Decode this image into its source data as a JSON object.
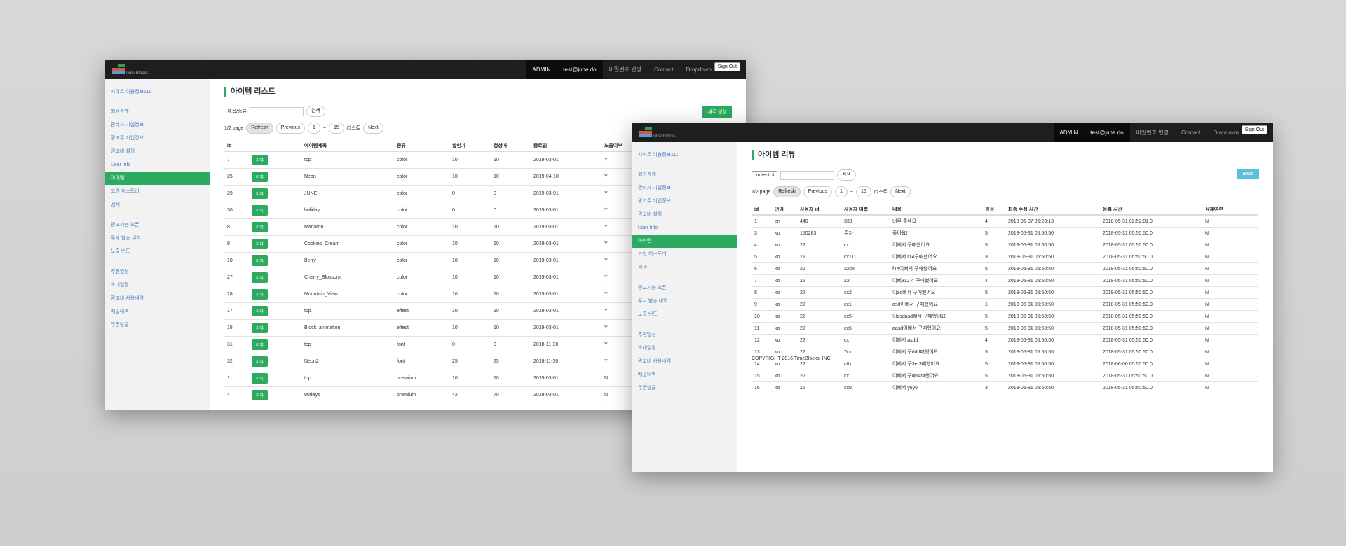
{
  "window1": {
    "nav": {
      "logo_text": "Time Blocks",
      "items": [
        "ADMIN",
        "test@june.do",
        "비밀번호 변경",
        "Contact",
        "Dropdown"
      ],
      "signout": "Sign Out"
    },
    "sidebar": {
      "items": [
        "사이트 이용정보111",
        "회원통계",
        "관리자 기업정보",
        "광고주 기업정보",
        "광고비 설정",
        "User Info",
        "아이템",
        "코인 히스토리",
        "검색",
        "광고기능 오픈",
        "푸시 발송 내역",
        "노출 빈도",
        "추천일정",
        "초대일정",
        "광고비 사용내역",
        "매출내역",
        "쿠폰발급"
      ],
      "active": "아이템"
    },
    "title": "아이템 리스트",
    "search_label": "- 제목/종류",
    "search_button": "검색",
    "new_button": "새로 생성",
    "pager": {
      "page": "1/2 page",
      "refresh": "Refresh",
      "previous": "Previous",
      "from": "1",
      "sep": "~",
      "to": "15",
      "unit": "리스트",
      "next": "Next"
    },
    "table": {
      "headers": [
        "id",
        "",
        "아이템제목",
        "종류",
        "할인가",
        "정상가",
        "종료일",
        "노출여부"
      ],
      "review_label": "리뷰",
      "rows": [
        [
          "7",
          "top",
          "color",
          "10",
          "10",
          "2019-03-01",
          "Y"
        ],
        [
          "25",
          "Neon",
          "color",
          "10",
          "10",
          "2019-04-10",
          "Y"
        ],
        [
          "29",
          "JUNE",
          "color",
          "0",
          "0",
          "2019-03-01",
          "Y"
        ],
        [
          "30",
          "holiday",
          "color",
          "0",
          "0",
          "2019-03-01",
          "Y"
        ],
        [
          "8",
          "Macaron",
          "color",
          "10",
          "10",
          "2019-03-01",
          "Y"
        ],
        [
          "9",
          "Cookies_Cream",
          "color",
          "10",
          "10",
          "2019-03-01",
          "Y"
        ],
        [
          "10",
          "Berry",
          "color",
          "10",
          "10",
          "2019-03-01",
          "Y"
        ],
        [
          "27",
          "Cherry_Blossom",
          "color",
          "10",
          "10",
          "2019-03-01",
          "Y"
        ],
        [
          "28",
          "Mountain_View",
          "color",
          "10",
          "10",
          "2019-03-01",
          "Y"
        ],
        [
          "17",
          "top",
          "effect",
          "10",
          "10",
          "2019-03-01",
          "Y"
        ],
        [
          "18",
          "Block_animation",
          "effect",
          "10",
          "10",
          "2019-03-01",
          "Y"
        ],
        [
          "31",
          "top",
          "font",
          "0",
          "0",
          "2018-11-30",
          "Y"
        ],
        [
          "32",
          "Neon2",
          "font",
          "25",
          "25",
          "2018-11-30",
          "Y"
        ],
        [
          "1",
          "top",
          "premium",
          "10",
          "10",
          "2019-03-01",
          "N"
        ],
        [
          "4",
          "90days",
          "premium",
          "42",
          "70",
          "2019-03-01",
          "N"
        ]
      ]
    }
  },
  "window2": {
    "nav": {
      "logo_text": "Time Blocks",
      "items": [
        "ADMIN",
        "test@june.do",
        "비밀번호 변경",
        "Contact",
        "Dropdown"
      ],
      "signout": "Sign Out"
    },
    "sidebar": {
      "items": [
        "사이트 이용정보111",
        "회원통계",
        "관리자 기업정보",
        "광고주 기업정보",
        "광고비 설정",
        "User Info",
        "아이템",
        "코인 히스토리",
        "검색",
        "광고기능 오픈",
        "푸시 발송 내역",
        "노출 빈도",
        "추천일정",
        "초대일정",
        "광고비 사용내역",
        "매출내역",
        "쿠폰발급"
      ],
      "active": "아이템"
    },
    "title": "아이템 리뷰",
    "filter_select": "content",
    "search_button": "검색",
    "back_button": "Back",
    "pager": {
      "page": "1/2 page",
      "refresh": "Refresh",
      "previous": "Previous",
      "from": "1",
      "sep": "~",
      "to": "15",
      "unit": "리스트",
      "next": "Next"
    },
    "table": {
      "headers": [
        "id",
        "언어",
        "사용자 id",
        "사용자 이름",
        "내용",
        "평점",
        "최종 수정 시간",
        "등록 시간",
        "삭제여부"
      ],
      "rows": [
        [
          "1",
          "en",
          "440",
          "333",
          "너무 좋네요~",
          "4",
          "2018-06-07 06:20:13",
          "2018-05-31 02:52:01.0",
          "N"
        ],
        [
          "3",
          "ko",
          "150283",
          "주차",
          "좋아요!",
          "5",
          "2018-05-31 05:50:50",
          "2018-05-31 05:50:50.0",
          "N"
        ],
        [
          "4",
          "ko",
          "22",
          "cx",
          "이뻐서 구매했어요",
          "5",
          "2018-05-31 05:50:50",
          "2018-05-31 05:50:50.0",
          "N"
        ],
        [
          "5",
          "ko",
          "22",
          "cx111",
          "이뻐서 r14구매했어요",
          "3",
          "2018-05-31 05:50:50",
          "2018-05-31 05:50:50.0",
          "N"
        ],
        [
          "6",
          "ko",
          "22",
          "22cx",
          "f44이뻐서 구매했어요",
          "5",
          "2018-05-31 05:50:50",
          "2018-05-31 05:50:50.0",
          "N"
        ],
        [
          "7",
          "ko",
          "22",
          "22",
          "이뻐312서 구매했어요",
          "4",
          "2018-05-31 05:50:50",
          "2018-05-31 05:50:50.0",
          "N"
        ],
        [
          "8",
          "ko",
          "22",
          "cx2",
          "이ad뻐서 구매했어요",
          "5",
          "2018-05-31 05:50:50",
          "2018-05-31 05:50:50.0",
          "N"
        ],
        [
          "9",
          "ko",
          "22",
          "cx1",
          "asd이뻐서 구매했어요",
          "1",
          "2018-05-31 05:50:50",
          "2018-05-31 05:50:50.0",
          "N"
        ],
        [
          "10",
          "ko",
          "22",
          "cx5",
          "이asdasd뻐서 구매했어요",
          "5",
          "2018-05-31 05:50:50",
          "2018-05-31 05:50:50.0",
          "N"
        ],
        [
          "11",
          "ko",
          "22",
          "cx6",
          "aasd이뻐서 구매했어요",
          "5",
          "2018-05-31 05:50:50",
          "2018-05-31 05:50:50.0",
          "N"
        ],
        [
          "12",
          "ko",
          "22",
          "cx",
          "이뻐서 asdd",
          "4",
          "2018-05-31 05:50:50",
          "2018-05-31 05:50:50.0",
          "N"
        ],
        [
          "13",
          "ko",
          "22",
          "7cx",
          "이뻐서 구ddd매했어요",
          "5",
          "2018-05-31 05:50:50",
          "2018-05-31 05:50:50.0",
          "N"
        ],
        [
          "14",
          "ko",
          "22",
          "c8x",
          "이뻐서 구3er3매했어요",
          "5",
          "2018-05-31 05:50:50",
          "2018-06-06 05:50:50.0",
          "N"
        ],
        [
          "15",
          "ko",
          "22",
          "cx",
          "이뻐서 구매r4r4했어요",
          "5",
          "2018-05-31 05:50:50",
          "2018-05-31 05:50:50.0",
          "N"
        ],
        [
          "16",
          "ko",
          "22",
          "cx9",
          "이뻐서 y6y6",
          "3",
          "2018-05-31 05:50:50",
          "2018-05-31 05:50:50.0",
          "N"
        ]
      ]
    },
    "copyright": "COPYRIGHT 2016 TimeBlocks, INC."
  }
}
